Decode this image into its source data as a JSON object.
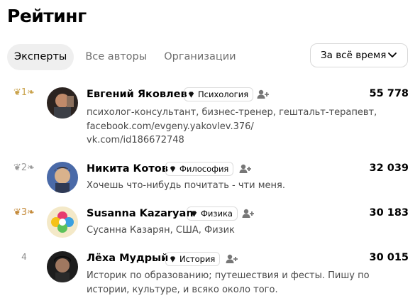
{
  "page": {
    "title": "Рейтинг"
  },
  "tabs": [
    {
      "label": "Эксперты"
    },
    {
      "label": "Все авторы"
    },
    {
      "label": "Организации"
    }
  ],
  "period": {
    "selected": "За всё время"
  },
  "experts": [
    {
      "rank": "1",
      "name": "Евгений Яковлев",
      "category": "Психология",
      "score": "55 778",
      "desc": [
        "психолог-консультант, бизнес-тренер, гештальт-терапевт,",
        "facebook.com/evgeny.yakovlev.376/",
        "vk.com/id186672748"
      ]
    },
    {
      "rank": "2",
      "name": "Никита Котов",
      "category": "Философия",
      "score": "32 039",
      "desc": [
        "Хочешь что-нибудь почитать - чти меня."
      ]
    },
    {
      "rank": "3",
      "name": "Susanna Kazaryan",
      "category": "Физика",
      "score": "30 183",
      "desc": [
        "Сусанна Казарян, США, Физик"
      ]
    },
    {
      "rank": "4",
      "name": "Лёха Мудрый",
      "category": "История",
      "score": "30 015",
      "desc": [
        "Историк по образованию; путешествия и фесты. Пишу по",
        "истории, культуре, и всяко около того."
      ]
    }
  ],
  "colors": {
    "gold": "#c9a24b",
    "silver": "#9a9a9a",
    "bronze": "#c48a3a",
    "text": "#000000",
    "muted": "#6f6f6f"
  }
}
